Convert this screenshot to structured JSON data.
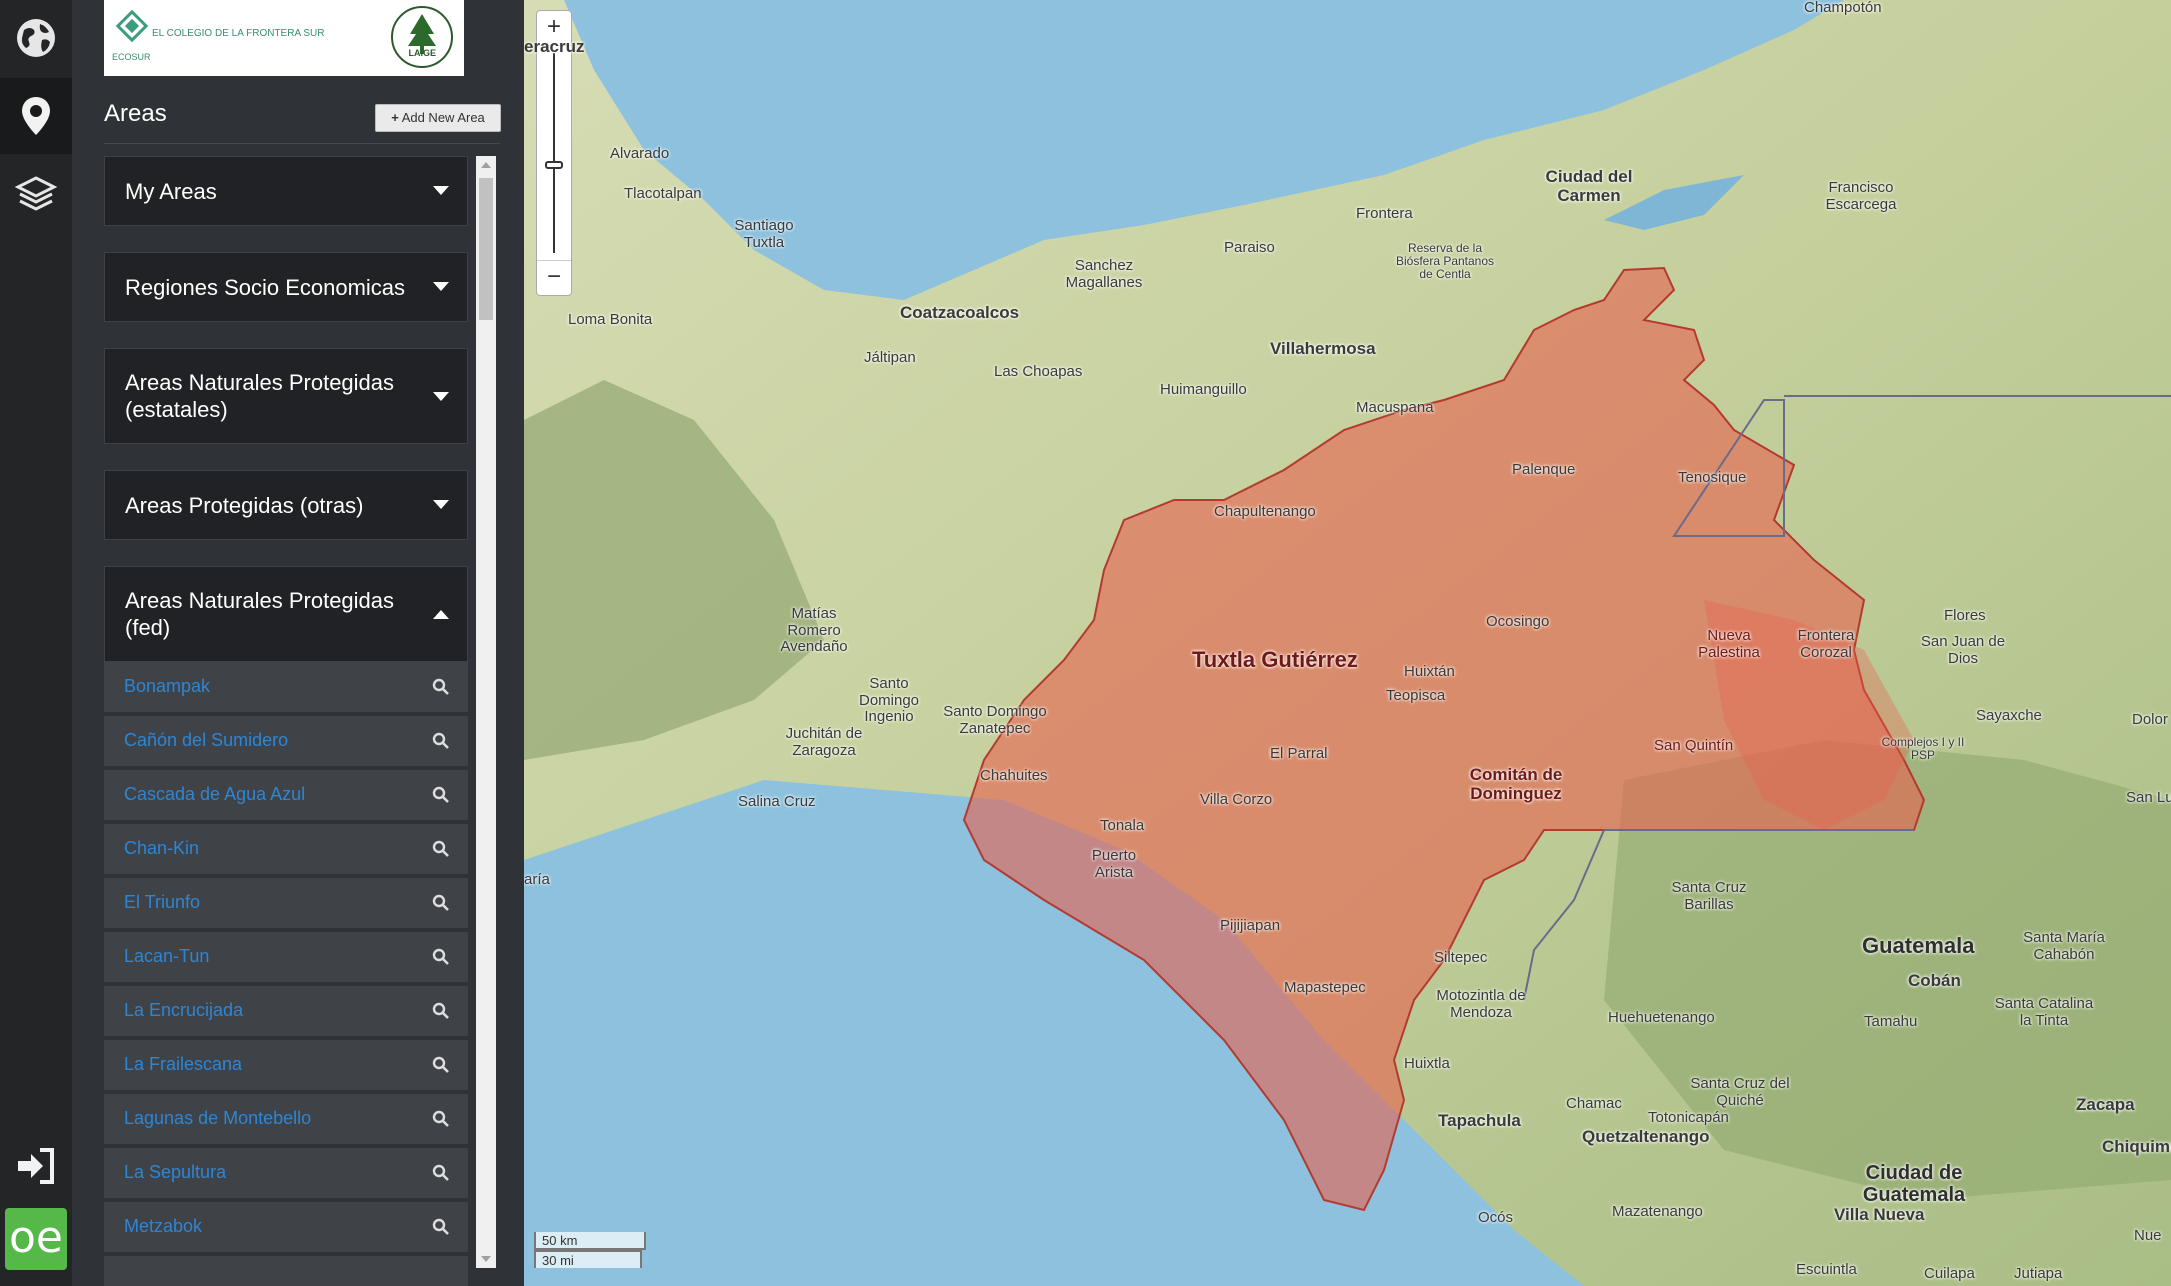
{
  "logo": {
    "text": "EL COLEGIO DE LA FRONTERA SUR",
    "subtext": "ECOSUR",
    "seal_text": "LAIGE"
  },
  "panel": {
    "title": "Areas",
    "add_button": "Add New Area",
    "categories": [
      {
        "label": "My Areas",
        "state": "collapsed"
      },
      {
        "label": "Regiones Socio Economicas",
        "state": "collapsed"
      },
      {
        "label": "Areas Naturales Protegidas (estatales)",
        "state": "collapsed"
      },
      {
        "label": "Areas Protegidas (otras)",
        "state": "collapsed"
      },
      {
        "label": "Areas Naturales Protegidas (fed)",
        "state": "expanded"
      }
    ],
    "items": [
      "Bonampak",
      "Cañón del Sumidero",
      "Cascada de Agua Azul",
      "Chan-Kin",
      "El Triunfo",
      "Lacan-Tun",
      "La Encrucijada",
      "La Frailescana",
      "Lagunas de Montebello",
      "La Sepultura",
      "Metzabok"
    ]
  },
  "map": {
    "zoom_in": "+",
    "zoom_out": "−",
    "scale_km": "50 km",
    "scale_mi": "30 mi",
    "labels": {
      "champoton": "Champotón",
      "veracruz": "eracruz",
      "alvarado": "Alvarado",
      "tlacotalpan": "Tlacotalpan",
      "santiago_tuxtla": "Santiago Tuxtla",
      "ciudad_carmen": "Ciudad del Carmen",
      "francisco_escarcega": "Francisco Escarcega",
      "frontera": "Frontera",
      "paraiso": "Paraiso",
      "reserva": "Reserva de la Biósfera Pantanos de Centla",
      "sanchez": "Sanchez Magallanes",
      "coatzacoalcos": "Coatzacoalcos",
      "villahermosa": "Villahermosa",
      "loma_bonita": "Loma Bonita",
      "jaltipan": "Jáltipan",
      "las_choapas": "Las Choapas",
      "huimanguillo": "Huimanguillo",
      "macuspana": "Macuspana",
      "palenque": "Palenque",
      "tenosique": "Tenosique",
      "chapultenango": "Chapultenango",
      "matias_romero": "Matías Romero Avendaño",
      "ocosingo": "Ocosingo",
      "tuxtla": "Tuxtla Gutiérrez",
      "huixtan": "Huixtán",
      "teopisca": "Teopisca",
      "nueva_palestina": "Nueva Palestina",
      "frontera_corozal": "Frontera Corozal",
      "flores": "Flores",
      "san_juan_dios": "San Juan de Dios",
      "santo_domingo_ingenio": "Santo Domingo Ingenio",
      "juchitan": "Juchitán de Zaragoza",
      "santo_domingo_zanatepec": "Santo Domingo Zanatepec",
      "el_parral": "El Parral",
      "comitan": "Comitán de Dominguez",
      "san_quintin": "San Quintín",
      "sayaxche": "Sayaxche",
      "complejos": "Complejos I y II PSP",
      "dolor": "Dolor",
      "chahuites": "Chahuites",
      "salina_cruz": "Salina Cruz",
      "villa_corzo": "Villa Corzo",
      "tonala": "Tonala",
      "puerto_arista": "Puerto Arista",
      "san_lu": "San Lu",
      "santa_cruz_barillas": "Santa Cruz Barillas",
      "maria": "aría",
      "pijijiapan": "Pijijiapan",
      "siltepec": "Siltepec",
      "guatemala": "Guatemala",
      "santa_maria_cahabon": "Santa María Cahabón",
      "coban": "Cobán",
      "mapastepec": "Mapastepec",
      "motozintla": "Motozintla de Mendoza",
      "huehuetenango": "Huehuetenango",
      "tamahu": "Tamahu",
      "santa_catalina": "Santa Catalina la Tinta",
      "huixtla": "Huixtla",
      "chamac": "Chamac",
      "santa_cruz_quiche": "Santa Cruz del Quiché",
      "zacapa": "Zacapa",
      "tapachula": "Tapachula",
      "totonicapan": "Totonicapán",
      "quetzaltenango": "Quetzaltenango",
      "chiquimula": "Chiquimula",
      "ciudad_guatemala": "Ciudad de Guatemala",
      "villa_nueva": "Villa Nueva",
      "mazatenango": "Mazatenango",
      "ocos": "Ocós",
      "nue": "Nue",
      "escuintla": "Escuintla",
      "cuilapa": "Cuilapa",
      "jutiapa": "Jutiapa"
    }
  },
  "colors": {
    "sea": "#8dc1de",
    "land": "#c9d4a8",
    "selection": "#e8604f",
    "link": "#2c86d6",
    "oe_green": "#55b848"
  },
  "icons": {
    "sidebar": [
      "globe-icon",
      "map-pin-icon",
      "layers-icon",
      "login-icon",
      "oe-logo-icon"
    ],
    "row": "search-icon"
  }
}
